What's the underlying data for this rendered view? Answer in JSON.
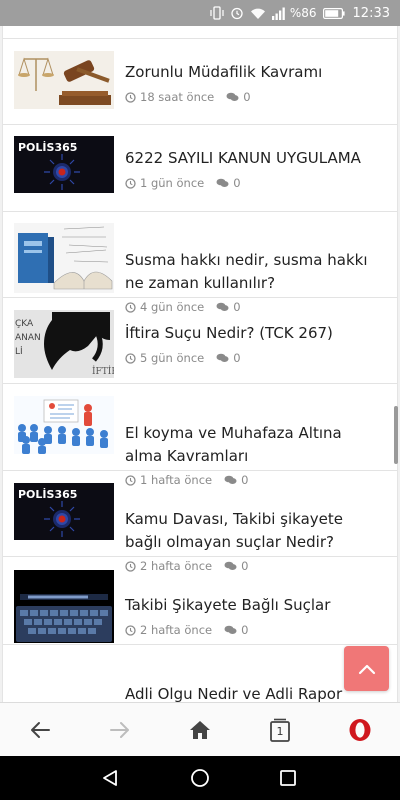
{
  "status_bar": {
    "battery_percent": "%86",
    "time": "12:33",
    "icons": [
      "vibrate-icon",
      "alarm-icon",
      "wifi-icon",
      "signal-icon",
      "battery-icon"
    ]
  },
  "articles": [
    {
      "title": "Zorunlu Müdafilik Kavramı",
      "time": "18 saat önce",
      "comments": "0",
      "thumb": "gavel"
    },
    {
      "title": "6222 SAYILI KANUN UYGULAMA",
      "time": "1 gün önce",
      "comments": "0",
      "thumb": "polis365",
      "thumb_text": "POLİS365"
    },
    {
      "title": "Susma hakkı nedir, susma hakkı ne zaman kullanılır?",
      "time": "4 gün önce",
      "comments": "0",
      "thumb": "book"
    },
    {
      "title": "İftira Suçu Nedir? (TCK 267)",
      "time": "5 gün önce",
      "comments": "0",
      "thumb": "iftira",
      "thumb_text": "İFTİR",
      "thumb_side_text": "ÇKA\nANAN\nLİ"
    },
    {
      "title": "El koyma ve Muhafaza Altına alma Kavramları",
      "time": "1 hafta önce",
      "comments": "0",
      "thumb": "classroom"
    },
    {
      "title": "Kamu Davası, Takibi şikayete bağlı olmayan suçlar Nedir?",
      "time": "2 hafta önce",
      "comments": "0",
      "thumb": "polis365",
      "thumb_text": "POLİS365"
    },
    {
      "title": "Takibi Şikayete Bağlı Suçlar",
      "time": "2 hafta önce",
      "comments": "0",
      "thumb": "keyboard"
    },
    {
      "title": "Adli Olgu Nedir ve Adli Rapor Nasıl Hazırlanır?",
      "time": "",
      "comments": "",
      "thumb": "none"
    }
  ],
  "toolbar": {
    "tab_count": "1",
    "icons": [
      "back-arrow-icon",
      "forward-arrow-icon",
      "home-icon",
      "tabs-icon",
      "opera-icon"
    ]
  },
  "back_to_top": {
    "icon": "chevron-up-icon",
    "color": "#f07777"
  },
  "navbar": {
    "icons": [
      "nav-back-icon",
      "nav-home-icon",
      "nav-recents-icon"
    ]
  },
  "colors": {
    "status_bar": "#9e9e9e",
    "title_text": "#222222",
    "meta_text": "#8a8a8a",
    "opera_red": "#d0171e"
  }
}
